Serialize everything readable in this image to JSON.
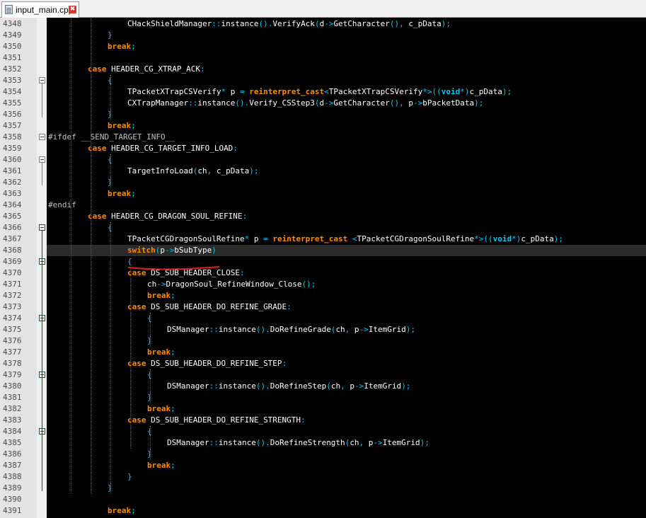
{
  "tab": {
    "filename": "input_main.cpp",
    "close_label": "✖"
  },
  "colors": {
    "keyword": "#ff8c00",
    "operator": "#00c8ff",
    "text": "#ffffff",
    "background": "#000000",
    "annotation": "#e02020"
  },
  "lines": [
    {
      "n": "4348",
      "indent": 112,
      "fold": "",
      "tokens": [
        [
          "t",
          "CHackShieldManager"
        ],
        [
          "o",
          "::"
        ],
        [
          "t",
          "instance"
        ],
        [
          "o",
          "()."
        ],
        [
          "t",
          "VerifyAck"
        ],
        [
          "o",
          "("
        ],
        [
          "t",
          "d"
        ],
        [
          "o",
          "->"
        ],
        [
          "t",
          "GetCharacter"
        ],
        [
          "o",
          "(),"
        ],
        [
          "t",
          " c_pData"
        ],
        [
          "o",
          ");"
        ]
      ]
    },
    {
      "n": "4349",
      "indent": 84,
      "fold": "",
      "tokens": [
        [
          "o",
          "}"
        ]
      ]
    },
    {
      "n": "4350",
      "indent": 84,
      "fold": "",
      "tokens": [
        [
          "k",
          "break"
        ],
        [
          "o",
          ";"
        ]
      ]
    },
    {
      "n": "4351",
      "indent": 0,
      "fold": "",
      "tokens": []
    },
    {
      "n": "4352",
      "indent": 56,
      "fold": "",
      "tokens": [
        [
          "k",
          "case"
        ],
        [
          "t",
          " HEADER_CG_XTRAP_ACK"
        ],
        [
          "o",
          ":"
        ]
      ]
    },
    {
      "n": "4353",
      "indent": 84,
      "fold": "box",
      "tokens": [
        [
          "o",
          "{"
        ]
      ]
    },
    {
      "n": "4354",
      "indent": 112,
      "fold": "",
      "tokens": [
        [
          "t",
          "TPacketXTrapCSVerify"
        ],
        [
          "o",
          "*"
        ],
        [
          "t",
          " p "
        ],
        [
          "o",
          "="
        ],
        [
          "t",
          " "
        ],
        [
          "k",
          "reinterpret_cast"
        ],
        [
          "o",
          "<"
        ],
        [
          "t",
          "TPacketXTrapCSVerify"
        ],
        [
          "o",
          "*>(("
        ],
        [
          "y",
          "void"
        ],
        [
          "o",
          "*)"
        ],
        [
          "t",
          "c_pData"
        ],
        [
          "o",
          ");"
        ]
      ]
    },
    {
      "n": "4355",
      "indent": 112,
      "fold": "",
      "tokens": [
        [
          "t",
          "CXTrapManager"
        ],
        [
          "o",
          "::"
        ],
        [
          "t",
          "instance"
        ],
        [
          "o",
          "()."
        ],
        [
          "t",
          "Verify_CSStep3"
        ],
        [
          "o",
          "("
        ],
        [
          "t",
          "d"
        ],
        [
          "o",
          "->"
        ],
        [
          "t",
          "GetCharacter"
        ],
        [
          "o",
          "(),"
        ],
        [
          "t",
          " p"
        ],
        [
          "o",
          "->"
        ],
        [
          "t",
          "bPacketData"
        ],
        [
          "o",
          ");"
        ]
      ]
    },
    {
      "n": "4356",
      "indent": 84,
      "fold": "",
      "tokens": [
        [
          "o",
          "}"
        ]
      ]
    },
    {
      "n": "4357",
      "indent": 84,
      "fold": "",
      "tokens": [
        [
          "k",
          "break"
        ],
        [
          "o",
          ";"
        ]
      ]
    },
    {
      "n": "4358",
      "indent": 0,
      "fold": "box",
      "tokens": [
        [
          "p",
          "#ifdef __SEND_TARGET_INFO__"
        ]
      ]
    },
    {
      "n": "4359",
      "indent": 56,
      "fold": "",
      "tokens": [
        [
          "k",
          "case"
        ],
        [
          "t",
          " HEADER_CG_TARGET_INFO_LOAD"
        ],
        [
          "o",
          ":"
        ]
      ]
    },
    {
      "n": "4360",
      "indent": 84,
      "fold": "box",
      "tokens": [
        [
          "o",
          "{"
        ]
      ]
    },
    {
      "n": "4361",
      "indent": 112,
      "fold": "",
      "tokens": [
        [
          "t",
          "TargetInfoLoad"
        ],
        [
          "o",
          "("
        ],
        [
          "t",
          "ch"
        ],
        [
          "o",
          ","
        ],
        [
          "t",
          " c_pData"
        ],
        [
          "o",
          ");"
        ]
      ]
    },
    {
      "n": "4362",
      "indent": 84,
      "fold": "",
      "tokens": [
        [
          "o",
          "}"
        ]
      ]
    },
    {
      "n": "4363",
      "indent": 84,
      "fold": "",
      "tokens": [
        [
          "k",
          "break"
        ],
        [
          "o",
          ";"
        ]
      ]
    },
    {
      "n": "4364",
      "indent": 0,
      "fold": "",
      "tokens": [
        [
          "p",
          "#endif"
        ]
      ]
    },
    {
      "n": "4365",
      "indent": 56,
      "fold": "",
      "tokens": [
        [
          "k",
          "case"
        ],
        [
          "t",
          " HEADER_CG_DRAGON_SOUL_REFINE"
        ],
        [
          "o",
          ":"
        ]
      ]
    },
    {
      "n": "4366",
      "indent": 84,
      "fold": "red",
      "tokens": [
        [
          "o",
          "{"
        ]
      ]
    },
    {
      "n": "4367",
      "indent": 112,
      "fold": "",
      "tokens": [
        [
          "t",
          "TPacketCGDragonSoulRefine"
        ],
        [
          "o",
          "*"
        ],
        [
          "t",
          " p "
        ],
        [
          "o",
          "="
        ],
        [
          "t",
          " "
        ],
        [
          "k",
          "reinterpret_cast"
        ],
        [
          "t",
          " "
        ],
        [
          "o",
          "<"
        ],
        [
          "t",
          "TPacketCGDragonSoulRefine"
        ],
        [
          "o",
          "*>(("
        ],
        [
          "y",
          "void"
        ],
        [
          "o",
          "*)"
        ],
        [
          "t",
          "c_pData"
        ],
        [
          "o",
          ");"
        ]
      ]
    },
    {
      "n": "4368",
      "indent": 112,
      "fold": "",
      "current": true,
      "tokens": [
        [
          "k",
          "switch"
        ],
        [
          "o",
          "("
        ],
        [
          "t",
          "p"
        ],
        [
          "o",
          "->"
        ],
        [
          "t",
          "bSubType"
        ],
        [
          "o",
          ")"
        ]
      ]
    },
    {
      "n": "4369",
      "indent": 112,
      "fold": "red",
      "tokens": [
        [
          "o",
          "{"
        ]
      ]
    },
    {
      "n": "4370",
      "indent": 112,
      "fold": "",
      "tokens": [
        [
          "k",
          "case"
        ],
        [
          "t",
          " DS_SUB_HEADER_CLOSE"
        ],
        [
          "o",
          ":"
        ]
      ]
    },
    {
      "n": "4371",
      "indent": 140,
      "fold": "",
      "tokens": [
        [
          "t",
          "ch"
        ],
        [
          "o",
          "->"
        ],
        [
          "t",
          "DragonSoul_RefineWindow_Close"
        ],
        [
          "o",
          "();"
        ]
      ]
    },
    {
      "n": "4372",
      "indent": 140,
      "fold": "",
      "tokens": [
        [
          "k",
          "break"
        ],
        [
          "o",
          ";"
        ]
      ]
    },
    {
      "n": "4373",
      "indent": 112,
      "fold": "",
      "tokens": [
        [
          "k",
          "case"
        ],
        [
          "t",
          " DS_SUB_HEADER_DO_REFINE_GRADE"
        ],
        [
          "o",
          ":"
        ]
      ]
    },
    {
      "n": "4374",
      "indent": 140,
      "fold": "red",
      "tokens": [
        [
          "o",
          "{"
        ]
      ]
    },
    {
      "n": "4375",
      "indent": 168,
      "fold": "",
      "tokens": [
        [
          "t",
          "DSManager"
        ],
        [
          "o",
          "::"
        ],
        [
          "t",
          "instance"
        ],
        [
          "o",
          "()."
        ],
        [
          "t",
          "DoRefineGrade"
        ],
        [
          "o",
          "("
        ],
        [
          "t",
          "ch"
        ],
        [
          "o",
          ","
        ],
        [
          "t",
          " p"
        ],
        [
          "o",
          "->"
        ],
        [
          "t",
          "ItemGrid"
        ],
        [
          "o",
          ");"
        ]
      ]
    },
    {
      "n": "4376",
      "indent": 140,
      "fold": "",
      "tokens": [
        [
          "o",
          "}"
        ]
      ]
    },
    {
      "n": "4377",
      "indent": 140,
      "fold": "",
      "tokens": [
        [
          "k",
          "break"
        ],
        [
          "o",
          ";"
        ]
      ]
    },
    {
      "n": "4378",
      "indent": 112,
      "fold": "",
      "tokens": [
        [
          "k",
          "case"
        ],
        [
          "t",
          " DS_SUB_HEADER_DO_REFINE_STEP"
        ],
        [
          "o",
          ":"
        ]
      ]
    },
    {
      "n": "4379",
      "indent": 140,
      "fold": "red",
      "tokens": [
        [
          "o",
          "{"
        ]
      ]
    },
    {
      "n": "4380",
      "indent": 168,
      "fold": "",
      "tokens": [
        [
          "t",
          "DSManager"
        ],
        [
          "o",
          "::"
        ],
        [
          "t",
          "instance"
        ],
        [
          "o",
          "()."
        ],
        [
          "t",
          "DoRefineStep"
        ],
        [
          "o",
          "("
        ],
        [
          "t",
          "ch"
        ],
        [
          "o",
          ","
        ],
        [
          "t",
          " p"
        ],
        [
          "o",
          "->"
        ],
        [
          "t",
          "ItemGrid"
        ],
        [
          "o",
          ");"
        ]
      ]
    },
    {
      "n": "4381",
      "indent": 140,
      "fold": "",
      "tokens": [
        [
          "o",
          "}"
        ]
      ]
    },
    {
      "n": "4382",
      "indent": 140,
      "fold": "",
      "tokens": [
        [
          "k",
          "break"
        ],
        [
          "o",
          ";"
        ]
      ]
    },
    {
      "n": "4383",
      "indent": 112,
      "fold": "",
      "tokens": [
        [
          "k",
          "case"
        ],
        [
          "t",
          " DS_SUB_HEADER_DO_REFINE_STRENGTH"
        ],
        [
          "o",
          ":"
        ]
      ]
    },
    {
      "n": "4384",
      "indent": 140,
      "fold": "red",
      "tokens": [
        [
          "o",
          "{"
        ]
      ]
    },
    {
      "n": "4385",
      "indent": 168,
      "fold": "",
      "tokens": [
        [
          "t",
          "DSManager"
        ],
        [
          "o",
          "::"
        ],
        [
          "t",
          "instance"
        ],
        [
          "o",
          "()."
        ],
        [
          "t",
          "DoRefineStrength"
        ],
        [
          "o",
          "("
        ],
        [
          "t",
          "ch"
        ],
        [
          "o",
          ","
        ],
        [
          "t",
          " p"
        ],
        [
          "o",
          "->"
        ],
        [
          "t",
          "ItemGrid"
        ],
        [
          "o",
          ");"
        ]
      ]
    },
    {
      "n": "4386",
      "indent": 140,
      "fold": "",
      "tokens": [
        [
          "o",
          "}"
        ]
      ]
    },
    {
      "n": "4387",
      "indent": 140,
      "fold": "",
      "tokens": [
        [
          "k",
          "break"
        ],
        [
          "o",
          ";"
        ]
      ]
    },
    {
      "n": "4388",
      "indent": 112,
      "fold": "",
      "tokens": [
        [
          "o",
          "}"
        ]
      ]
    },
    {
      "n": "4389",
      "indent": 84,
      "fold": "",
      "tokens": [
        [
          "o",
          "}"
        ]
      ]
    },
    {
      "n": "4390",
      "indent": 0,
      "fold": "",
      "tokens": []
    },
    {
      "n": "4391",
      "indent": 84,
      "fold": "",
      "tokens": [
        [
          "k",
          "break"
        ],
        [
          "o",
          ";"
        ]
      ]
    }
  ]
}
